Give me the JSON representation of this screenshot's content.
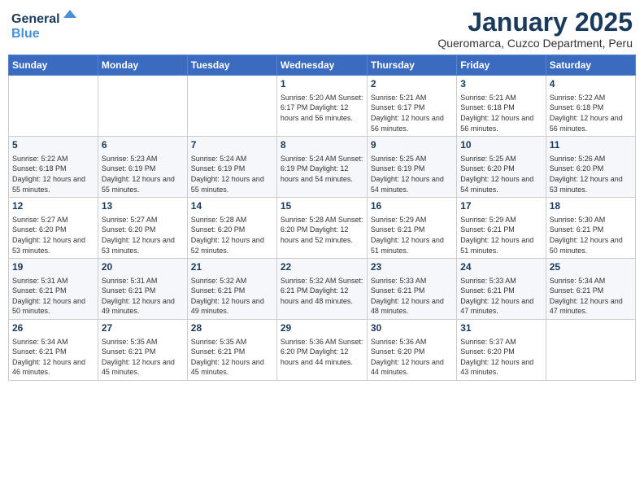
{
  "logo": {
    "line1": "General",
    "line2": "Blue"
  },
  "title": "January 2025",
  "subtitle": "Queromarca, Cuzco Department, Peru",
  "weekdays": [
    "Sunday",
    "Monday",
    "Tuesday",
    "Wednesday",
    "Thursday",
    "Friday",
    "Saturday"
  ],
  "weeks": [
    [
      {
        "day": "",
        "info": ""
      },
      {
        "day": "",
        "info": ""
      },
      {
        "day": "",
        "info": ""
      },
      {
        "day": "1",
        "info": "Sunrise: 5:20 AM\nSunset: 6:17 PM\nDaylight: 12 hours\nand 56 minutes."
      },
      {
        "day": "2",
        "info": "Sunrise: 5:21 AM\nSunset: 6:17 PM\nDaylight: 12 hours\nand 56 minutes."
      },
      {
        "day": "3",
        "info": "Sunrise: 5:21 AM\nSunset: 6:18 PM\nDaylight: 12 hours\nand 56 minutes."
      },
      {
        "day": "4",
        "info": "Sunrise: 5:22 AM\nSunset: 6:18 PM\nDaylight: 12 hours\nand 56 minutes."
      }
    ],
    [
      {
        "day": "5",
        "info": "Sunrise: 5:22 AM\nSunset: 6:18 PM\nDaylight: 12 hours\nand 55 minutes."
      },
      {
        "day": "6",
        "info": "Sunrise: 5:23 AM\nSunset: 6:19 PM\nDaylight: 12 hours\nand 55 minutes."
      },
      {
        "day": "7",
        "info": "Sunrise: 5:24 AM\nSunset: 6:19 PM\nDaylight: 12 hours\nand 55 minutes."
      },
      {
        "day": "8",
        "info": "Sunrise: 5:24 AM\nSunset: 6:19 PM\nDaylight: 12 hours\nand 54 minutes."
      },
      {
        "day": "9",
        "info": "Sunrise: 5:25 AM\nSunset: 6:19 PM\nDaylight: 12 hours\nand 54 minutes."
      },
      {
        "day": "10",
        "info": "Sunrise: 5:25 AM\nSunset: 6:20 PM\nDaylight: 12 hours\nand 54 minutes."
      },
      {
        "day": "11",
        "info": "Sunrise: 5:26 AM\nSunset: 6:20 PM\nDaylight: 12 hours\nand 53 minutes."
      }
    ],
    [
      {
        "day": "12",
        "info": "Sunrise: 5:27 AM\nSunset: 6:20 PM\nDaylight: 12 hours\nand 53 minutes."
      },
      {
        "day": "13",
        "info": "Sunrise: 5:27 AM\nSunset: 6:20 PM\nDaylight: 12 hours\nand 53 minutes."
      },
      {
        "day": "14",
        "info": "Sunrise: 5:28 AM\nSunset: 6:20 PM\nDaylight: 12 hours\nand 52 minutes."
      },
      {
        "day": "15",
        "info": "Sunrise: 5:28 AM\nSunset: 6:20 PM\nDaylight: 12 hours\nand 52 minutes."
      },
      {
        "day": "16",
        "info": "Sunrise: 5:29 AM\nSunset: 6:21 PM\nDaylight: 12 hours\nand 51 minutes."
      },
      {
        "day": "17",
        "info": "Sunrise: 5:29 AM\nSunset: 6:21 PM\nDaylight: 12 hours\nand 51 minutes."
      },
      {
        "day": "18",
        "info": "Sunrise: 5:30 AM\nSunset: 6:21 PM\nDaylight: 12 hours\nand 50 minutes."
      }
    ],
    [
      {
        "day": "19",
        "info": "Sunrise: 5:31 AM\nSunset: 6:21 PM\nDaylight: 12 hours\nand 50 minutes."
      },
      {
        "day": "20",
        "info": "Sunrise: 5:31 AM\nSunset: 6:21 PM\nDaylight: 12 hours\nand 49 minutes."
      },
      {
        "day": "21",
        "info": "Sunrise: 5:32 AM\nSunset: 6:21 PM\nDaylight: 12 hours\nand 49 minutes."
      },
      {
        "day": "22",
        "info": "Sunrise: 5:32 AM\nSunset: 6:21 PM\nDaylight: 12 hours\nand 48 minutes."
      },
      {
        "day": "23",
        "info": "Sunrise: 5:33 AM\nSunset: 6:21 PM\nDaylight: 12 hours\nand 48 minutes."
      },
      {
        "day": "24",
        "info": "Sunrise: 5:33 AM\nSunset: 6:21 PM\nDaylight: 12 hours\nand 47 minutes."
      },
      {
        "day": "25",
        "info": "Sunrise: 5:34 AM\nSunset: 6:21 PM\nDaylight: 12 hours\nand 47 minutes."
      }
    ],
    [
      {
        "day": "26",
        "info": "Sunrise: 5:34 AM\nSunset: 6:21 PM\nDaylight: 12 hours\nand 46 minutes."
      },
      {
        "day": "27",
        "info": "Sunrise: 5:35 AM\nSunset: 6:21 PM\nDaylight: 12 hours\nand 45 minutes."
      },
      {
        "day": "28",
        "info": "Sunrise: 5:35 AM\nSunset: 6:21 PM\nDaylight: 12 hours\nand 45 minutes."
      },
      {
        "day": "29",
        "info": "Sunrise: 5:36 AM\nSunset: 6:20 PM\nDaylight: 12 hours\nand 44 minutes."
      },
      {
        "day": "30",
        "info": "Sunrise: 5:36 AM\nSunset: 6:20 PM\nDaylight: 12 hours\nand 44 minutes."
      },
      {
        "day": "31",
        "info": "Sunrise: 5:37 AM\nSunset: 6:20 PM\nDaylight: 12 hours\nand 43 minutes."
      },
      {
        "day": "",
        "info": ""
      }
    ]
  ]
}
